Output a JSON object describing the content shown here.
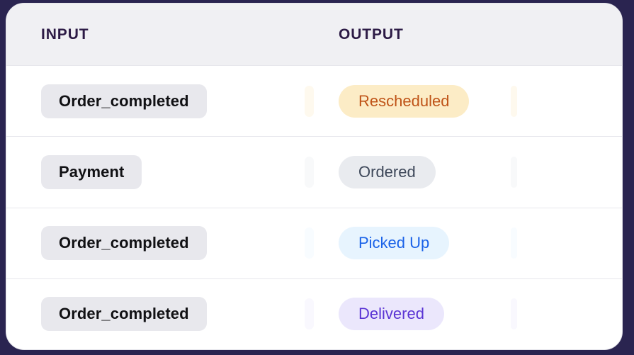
{
  "table": {
    "columns": [
      {
        "key": "input",
        "label": "INPUT"
      },
      {
        "key": "output",
        "label": "OUTPUT"
      }
    ],
    "rows": [
      {
        "input": "Order_completed",
        "output": "Rescheduled",
        "output_bg": "#fcecc6",
        "output_fg": "#bf5317"
      },
      {
        "input": "Payment",
        "output": "Ordered",
        "output_bg": "#e9ebef",
        "output_fg": "#3d4759"
      },
      {
        "input": "Order_completed",
        "output": "Picked Up",
        "output_bg": "#e7f4fe",
        "output_fg": "#1a62e8"
      },
      {
        "input": "Order_completed",
        "output": "Delivered",
        "output_bg": "#ebe7fc",
        "output_fg": "#5a34d4"
      }
    ]
  },
  "theme": {
    "page_background": "#2a2450",
    "card_background": "#ffffff",
    "header_background": "#f0f0f3",
    "header_text": "#2c1a45",
    "divider": "#e7e7ed",
    "input_pill_background": "#e8e8ed",
    "input_pill_text": "#111114"
  }
}
